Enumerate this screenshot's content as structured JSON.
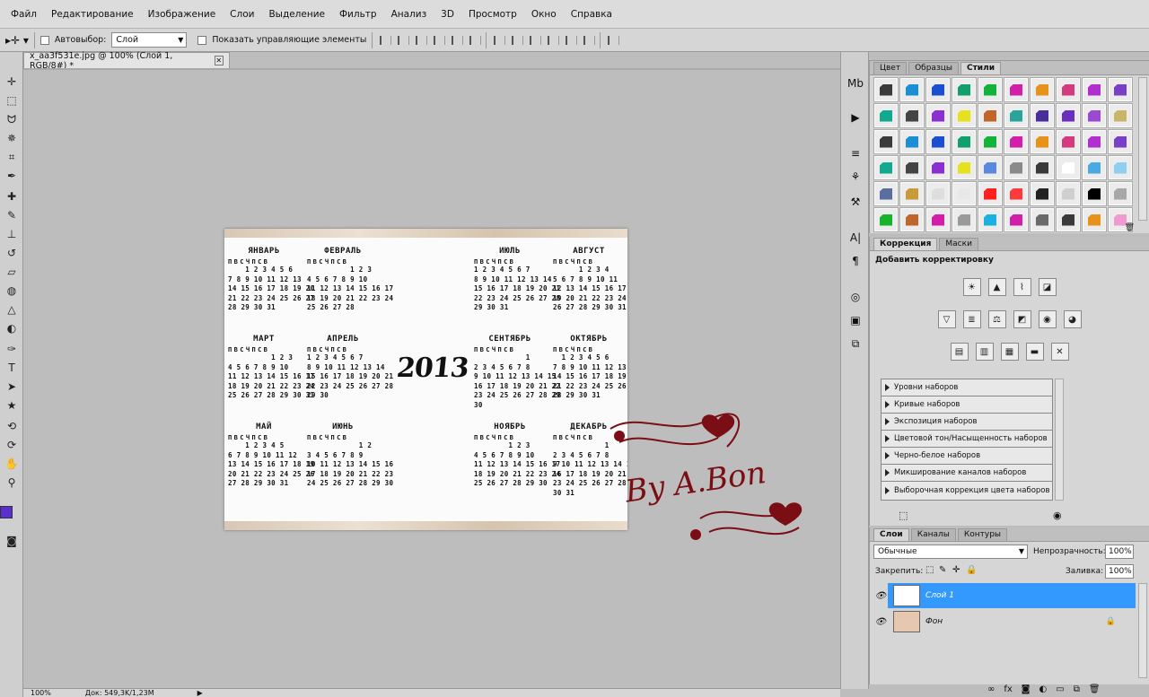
{
  "menu": [
    "Файл",
    "Редактирование",
    "Изображение",
    "Слои",
    "Выделение",
    "Фильтр",
    "Анализ",
    "3D",
    "Просмотр",
    "Окно",
    "Справка"
  ],
  "options": {
    "autoselect_label": "Автовыбор:",
    "autoselect_value": "Слой",
    "show_controls_label": "Показать управляющие элементы"
  },
  "document": {
    "tab_title": "x_aa3f531e.jpg @ 100% (Слой 1, RGB/8#) *",
    "zoom": "100%",
    "doc_size": "Док: 549,3K/1,23M"
  },
  "calendar": {
    "year": "2013",
    "weekdays": "ПВСЧПСВ",
    "months": [
      {
        "name": "ЯНВАРЬ",
        "rows": [
          "    1 2 3 4 5 6",
          "7 8 9 10 11 12 13",
          "14 15 16 17 18 19 20",
          "21 22 23 24 25 26 27",
          "28 29 30 31"
        ]
      },
      {
        "name": "ФЕВРАЛЬ",
        "rows": [
          "          1 2 3",
          "4 5 6 7 8 9 10",
          "11 12 13 14 15 16 17",
          "18 19 20 21 22 23 24",
          "25 26 27 28"
        ]
      },
      {
        "name": "МАРТ",
        "rows": [
          "          1 2 3",
          "4 5 6 7 8 9 10",
          "11 12 13 14 15 16 17",
          "18 19 20 21 22 23 24",
          "25 26 27 28 29 30 31"
        ]
      },
      {
        "name": "АПРЕЛЬ",
        "rows": [
          "1 2 3 4 5 6 7",
          "8 9 10 11 12 13 14",
          "15 16 17 18 19 20 21",
          "22 23 24 25 26 27 28",
          "29 30"
        ]
      },
      {
        "name": "МАЙ",
        "rows": [
          "    1 2 3 4 5",
          "6 7 8 9 10 11 12",
          "13 14 15 16 17 18 19",
          "20 21 22 23 24 25 26",
          "27 28 29 30 31"
        ]
      },
      {
        "name": "ИЮНЬ",
        "rows": [
          "            1 2",
          "3 4 5 6 7 8 9",
          "10 11 12 13 14 15 16",
          "17 18 19 20 21 22 23",
          "24 25 26 27 28 29 30"
        ]
      },
      {
        "name": "ИЮЛЬ",
        "rows": [
          "1 2 3 4 5 6 7",
          "8 9 10 11 12 13 14",
          "15 16 17 18 19 20 21",
          "22 23 24 25 26 27 28",
          "29 30 31"
        ]
      },
      {
        "name": "АВГУСТ",
        "rows": [
          "      1 2 3 4",
          "5 6 7 8 9 10 11",
          "12 13 14 15 16 17 18",
          "19 20 21 22 23 24 25",
          "26 27 28 29 30 31"
        ]
      },
      {
        "name": "СЕНТЯБРЬ",
        "rows": [
          "            1",
          "2 3 4 5 6 7 8",
          "9 10 11 12 13 14 15",
          "16 17 18 19 20 21 22",
          "23 24 25 26 27 28 29",
          "30"
        ]
      },
      {
        "name": "ОКТЯБРЬ",
        "rows": [
          "  1 2 3 4 5 6",
          "7 8 9 10 11 12 13",
          "14 15 16 17 18 19 20",
          "21 22 23 24 25 26 27",
          "28 29 30 31"
        ]
      },
      {
        "name": "НОЯБРЬ",
        "rows": [
          "        1 2 3",
          "4 5 6 7 8 9 10",
          "11 12 13 14 15 16 17",
          "18 19 20 21 22 23 24",
          "25 26 27 28 29 30"
        ]
      },
      {
        "name": "ДЕКАБРЬ",
        "rows": [
          "            1",
          "2 3 4 5 6 7 8",
          "9 10 11 12 13 14 15",
          "16 17 18 19 20 21 22",
          "23 24 25 26 27 28 29",
          "30 31"
        ]
      }
    ]
  },
  "watermark": "By A.Bon",
  "styles_panel": {
    "tabs": [
      "Цвет",
      "Образцы",
      "Стили"
    ],
    "active_tab": "Стили",
    "swatch_colors": [
      "#3a3a3a",
      "#1a8fd6",
      "#1c4fd0",
      "#11a06b",
      "#13b23a",
      "#d21ea8",
      "#e7921a",
      "#d43b7e",
      "#b12fcf",
      "#7a3fc7",
      "#13a890",
      "#444444",
      "#8a2fd0",
      "#e5e11a",
      "#c0662a",
      "#2aa39a",
      "#4a2f9c",
      "#6a2fbf",
      "#9a4ad0",
      "#c9b46a",
      "#3a3a3a",
      "#1a8fd6",
      "#1c4fd0",
      "#11a06b",
      "#13b23a",
      "#d21ea8",
      "#e7921a",
      "#d43b7e",
      "#b12fcf",
      "#7a3fc7",
      "#13a890",
      "#444444",
      "#8a2fd0",
      "#e5e11a",
      "#5a8ae0",
      "#8a8a8a",
      "#3a3a3a",
      "#ffffff",
      "#4aa9e0",
      "#8fcff0",
      "#5a6fa0",
      "#c79a3a",
      "#dedede",
      "#e8e8e8",
      "#ff2020",
      "#ff3a3a",
      "#222222",
      "#cfcfcf",
      "#000000",
      "#a8a8a8",
      "#17b32a",
      "#c0662a",
      "#d21ea8",
      "#9a9a9a",
      "#1ab0e0",
      "#d21ea8",
      "#6a6a6a",
      "#3a3a3a",
      "#e7921a",
      "#f09ad0"
    ]
  },
  "adjustments": {
    "tabs": [
      "Коррекция",
      "Маски"
    ],
    "active_tab": "Коррекция",
    "title": "Добавить корректировку",
    "presets": [
      "Уровни наборов",
      "Кривые наборов",
      "Экспозиция наборов",
      "Цветовой тон/Насыщенность наборов",
      "Черно-белое наборов",
      "Микширование каналов наборов",
      "Выборочная коррекция цвета наборов"
    ]
  },
  "layers": {
    "tabs": [
      "Слои",
      "Каналы",
      "Контуры"
    ],
    "active_tab": "Слои",
    "blend_mode": "Обычные",
    "opacity_label": "Непрозрачность:",
    "opacity_value": "100%",
    "lock_label": "Закрепить:",
    "fill_label": "Заливка:",
    "fill_value": "100%",
    "items": [
      {
        "name": "Слой 1",
        "selected": true
      },
      {
        "name": "Фон",
        "selected": false
      }
    ]
  },
  "colors": {
    "foreground": "#5a2fd0",
    "background": "#ffffff",
    "selection": "#3399ff",
    "watermark": "#7a0e14"
  }
}
